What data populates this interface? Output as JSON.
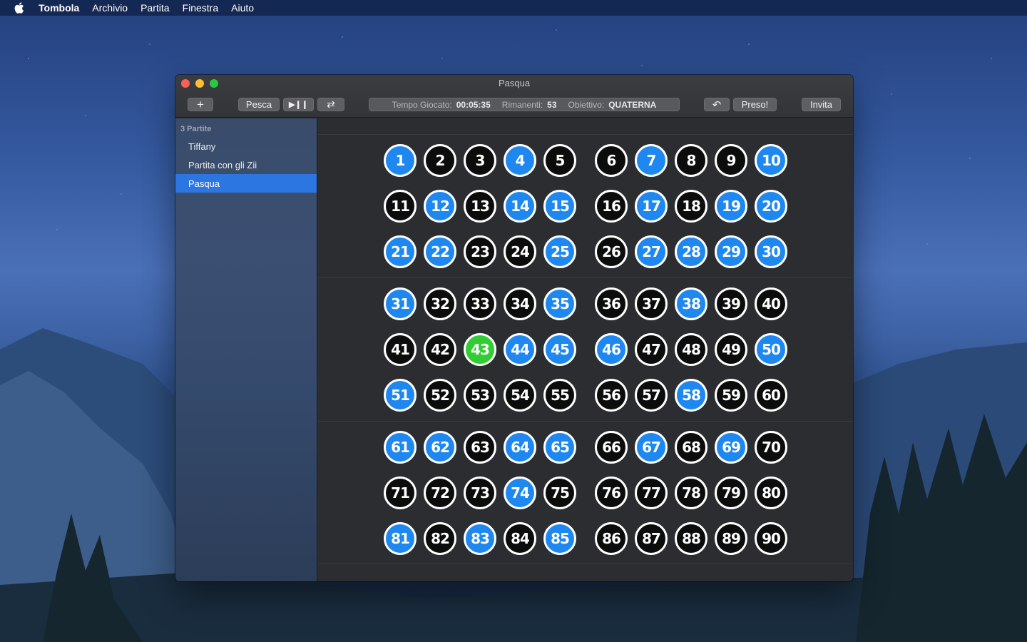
{
  "menubar": {
    "app_name": "Tombola",
    "menus": [
      "Archivio",
      "Partita",
      "Finestra",
      "Aiuto"
    ]
  },
  "window": {
    "title": "Pasqua"
  },
  "toolbar": {
    "add_label": "+",
    "pesca_label": "Pesca",
    "play_pause_label": "▶︎❙❙",
    "repeat_label": "⇄",
    "undo_label": "↶",
    "preso_label": "Preso!",
    "invita_label": "Invita",
    "status": {
      "tempo_label": "Tempo Giocato:",
      "tempo_value": "00:05:35",
      "rimanenti_label": "Rimanenti:",
      "rimanenti_value": "53",
      "obiettivo_label": "Obiettivo:",
      "obiettivo_value": "QUATERNA"
    }
  },
  "sidebar": {
    "header": "3 Partite",
    "items": [
      {
        "label": "Tiffany",
        "selected": false
      },
      {
        "label": "Partita con gli Zii",
        "selected": false
      },
      {
        "label": "Pasqua",
        "selected": true
      }
    ]
  },
  "board": {
    "colors": {
      "drawn": "#1e88f0",
      "not_drawn": "#0c0c0d",
      "last_drawn": "#32cd32"
    },
    "last_drawn": 43,
    "drawn_numbers": [
      1,
      4,
      7,
      10,
      12,
      14,
      15,
      17,
      19,
      20,
      21,
      22,
      25,
      27,
      28,
      29,
      30,
      31,
      35,
      38,
      44,
      45,
      46,
      50,
      51,
      58,
      61,
      62,
      64,
      65,
      67,
      69,
      74,
      81,
      83,
      85
    ]
  }
}
